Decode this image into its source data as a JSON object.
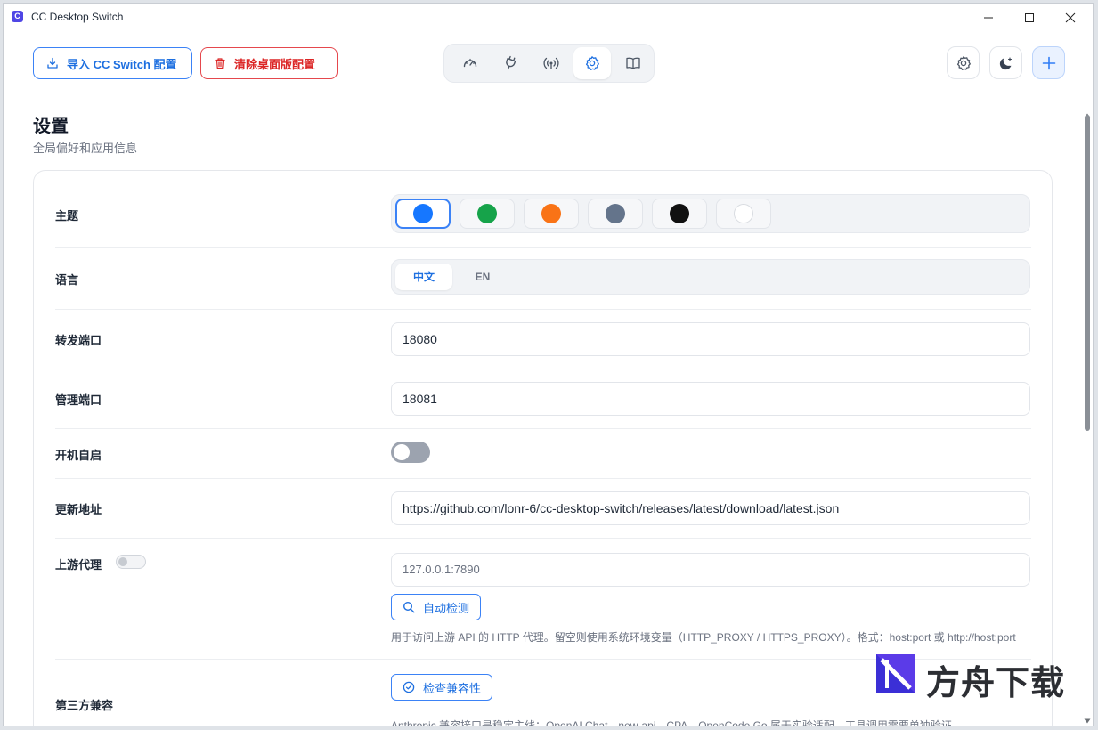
{
  "window": {
    "title": "CC Desktop Switch",
    "app_icon": "C"
  },
  "toolbar": {
    "import_label": "导入 CC Switch 配置",
    "clear_label": "清除桌面版配置",
    "nav_icons": [
      "gauge-icon",
      "plug-icon",
      "broadcast-icon",
      "settings-icon",
      "book-icon"
    ],
    "active_nav": "settings-icon"
  },
  "page": {
    "title": "设置",
    "subtitle": "全局偏好和应用信息"
  },
  "settings": {
    "theme": {
      "label": "主题",
      "swatches": [
        "#1677ff",
        "#16a34a",
        "#f97316",
        "#64748b",
        "#111111",
        "#ffffff"
      ],
      "selected_index": 0
    },
    "language": {
      "label": "语言",
      "options": [
        "中文",
        "EN"
      ],
      "selected": "中文"
    },
    "forward_port": {
      "label": "转发端口",
      "value": "18080"
    },
    "admin_port": {
      "label": "管理端口",
      "value": "18081"
    },
    "autostart": {
      "label": "开机自启",
      "enabled": false
    },
    "update_url": {
      "label": "更新地址",
      "value": "https://github.com/lonr-6/cc-desktop-switch/releases/latest/download/latest.json"
    },
    "upstream_proxy": {
      "label": "上游代理",
      "enabled": false,
      "placeholder": "127.0.0.1:7890",
      "detect_label": "自动检测",
      "hint": "用于访问上游 API 的 HTTP 代理。留空则使用系统环境变量（HTTP_PROXY / HTTPS_PROXY）。格式：host:port 或 http://host:port"
    },
    "third_party": {
      "label": "第三方兼容",
      "check_label": "检查兼容性",
      "hint": "Anthropic 兼容接口是稳定主线；OpenAI Chat、new-api、CPA、OpenCode Go 属于实验适配，工具调用需要单独验证。"
    }
  },
  "watermark": {
    "text": "方舟下载"
  },
  "colors": {
    "accent": "#1d6fe0",
    "danger": "#dc2626",
    "border": "#e2e5ea"
  }
}
